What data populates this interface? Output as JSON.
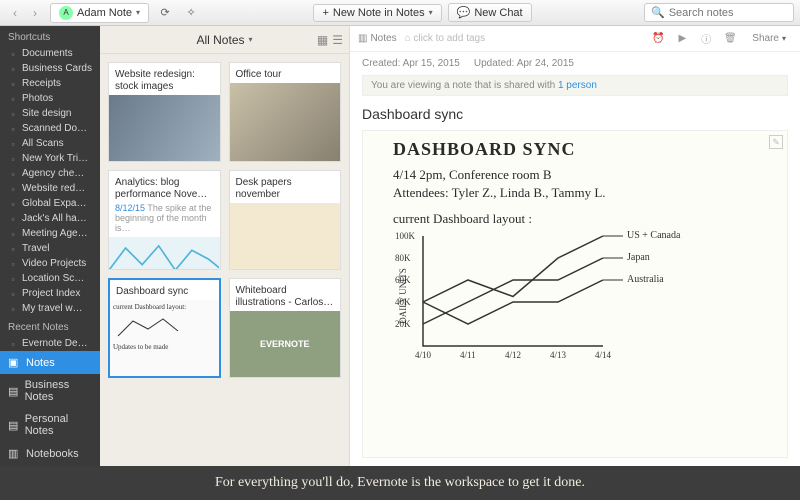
{
  "toolbar": {
    "user": "Adam Note",
    "new_note": "New Note in Notes",
    "new_chat": "New Chat",
    "search_placeholder": "Search notes"
  },
  "sidebar": {
    "shortcuts_label": "Shortcuts",
    "shortcuts": [
      "Documents",
      "Business Cards",
      "Receipts",
      "Photos",
      "Site design",
      "Scanned Do…",
      "All Scans",
      "New York Tri…",
      "Agency che…",
      "Website red…",
      "Global Expa…",
      "Jack's All ha…",
      "Meeting Age…",
      "Travel",
      "Video Projects",
      "Location Sc…",
      "Project Index",
      "My travel w…"
    ],
    "recent_label": "Recent Notes",
    "recent": [
      "Evernote De…"
    ],
    "nav": {
      "notes": "Notes",
      "business": "Business Notes",
      "personal": "Personal Notes",
      "notebooks": "Notebooks"
    }
  },
  "notelist": {
    "header": "All Notes",
    "cards": [
      {
        "title": "Website redesign: stock images"
      },
      {
        "title": "Office tour"
      },
      {
        "title": "Analytics: blog performance Nove…",
        "date": "8/12/15",
        "snippet": "The spike at the beginning of the month is…"
      },
      {
        "title": "Desk papers november"
      },
      {
        "title": "Dashboard sync"
      },
      {
        "title": "Whiteboard illustrations - Carlos…"
      }
    ]
  },
  "note": {
    "crumb": "Notes",
    "tag_placeholder": "click to add tags",
    "created_lbl": "Created:",
    "created": "Apr 15, 2015",
    "updated_lbl": "Updated:",
    "updated": "Apr 24, 2015",
    "share_msg": "You are viewing a note that is shared with ",
    "share_link": "1 person",
    "share_btn": "Share",
    "title": "Dashboard sync",
    "hand_title": "DASHBOARD SYNC",
    "hand_line1": "4/14   2pm,  Conference  room  B",
    "hand_line2": "Attendees:  Tyler Z.,  Linda B.,  Tammy L.",
    "hand_line3": "current  Dashboard  layout :",
    "legend": [
      "US + Canada",
      "Japan",
      "Australia"
    ],
    "ylabel": "DAILY UNITS"
  },
  "caption": "For everything you'll do, Evernote is the workspace to get it done.",
  "chart_data": {
    "type": "line",
    "title": "",
    "xlabel": "",
    "ylabel": "DAILY UNITS",
    "categories": [
      "4/10",
      "4/11",
      "4/12",
      "4/13",
      "4/14"
    ],
    "y_ticks": [
      "20K",
      "40K",
      "60K",
      "80K",
      "100K"
    ],
    "ylim": [
      0,
      100
    ],
    "series": [
      {
        "name": "US + Canada",
        "values": [
          40,
          60,
          45,
          80,
          100
        ]
      },
      {
        "name": "Japan",
        "values": [
          20,
          40,
          60,
          60,
          80
        ]
      },
      {
        "name": "Australia",
        "values": [
          40,
          20,
          40,
          40,
          60
        ]
      }
    ]
  }
}
